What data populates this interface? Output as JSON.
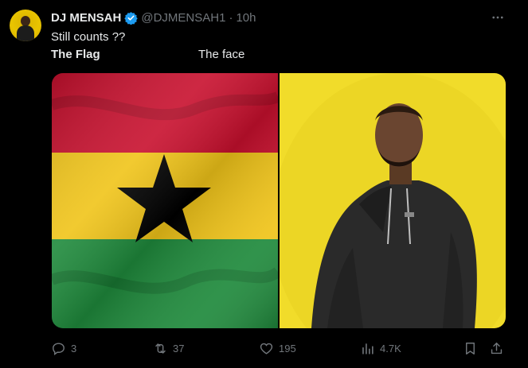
{
  "user": {
    "display_name": "DJ MENSAH",
    "handle": "@DJMENSAH1",
    "separator": "·",
    "time": "10h"
  },
  "tweet": {
    "line1": "Still counts ??",
    "left_caption": "The Flag",
    "right_caption": "The face"
  },
  "actions": {
    "replies": "3",
    "retweets": "37",
    "likes": "195",
    "views": "4.7K"
  },
  "colors": {
    "verified": "#1d9bf0",
    "flag_red": "#c8102e",
    "flag_yellow": "#f0c419",
    "flag_green": "#1f8a3c",
    "photo_bg": "#f1dc2a"
  },
  "icons": [
    "verified-badge-icon",
    "more-icon",
    "reply-icon",
    "retweet-icon",
    "like-icon",
    "views-icon",
    "bookmark-icon",
    "share-icon"
  ]
}
